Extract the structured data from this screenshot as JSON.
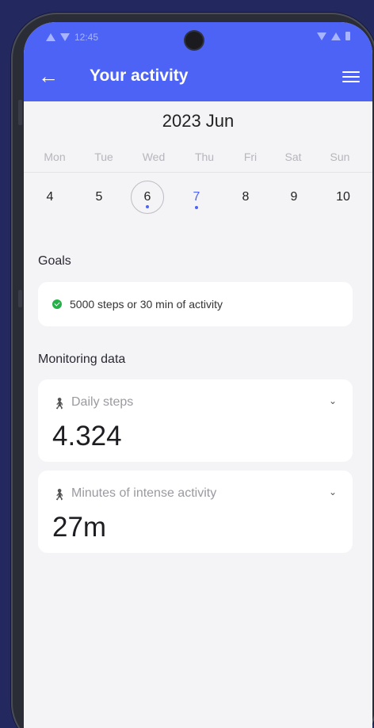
{
  "status_bar": {
    "time": "12:45"
  },
  "header": {
    "back_icon": "arrow-left-icon",
    "title": "Your activity",
    "menu_icon": "hamburger-menu-icon",
    "color": "#4d63f6"
  },
  "calendar": {
    "month": "2023 Jun",
    "weekdays": [
      "Mon",
      "Tue",
      "Wed",
      "Thu",
      "Fri",
      "Sat",
      "Sun"
    ],
    "days": [
      "4",
      "5",
      "6",
      "7",
      "8",
      "9",
      "10"
    ],
    "selected_day": "6",
    "highlighted_day": "7"
  },
  "goals": {
    "heading": "Goals",
    "items": [
      {
        "text": "5000 steps or 30 min of activity",
        "status_color": "#26b04a"
      }
    ]
  },
  "monitoring": {
    "heading": "Monitoring data",
    "cards": [
      {
        "label": "Daily steps",
        "value": "4.324",
        "icon": "walking-person-icon"
      },
      {
        "label": "Minutes of intense activity",
        "value": "27m",
        "icon": "walking-person-icon"
      }
    ]
  }
}
